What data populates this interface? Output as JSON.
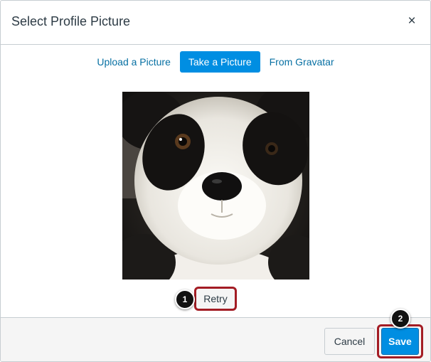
{
  "dialog": {
    "title": "Select Profile Picture",
    "close_symbol": "×"
  },
  "tabs": [
    {
      "label": "Upload a Picture",
      "active": false
    },
    {
      "label": "Take a Picture",
      "active": true
    },
    {
      "label": "From Gravatar",
      "active": false
    }
  ],
  "retry_label": "Retry",
  "callouts": [
    "1",
    "2"
  ],
  "footer": {
    "cancel_label": "Cancel",
    "save_label": "Save"
  },
  "colors": {
    "accent": "#008ee2",
    "link": "#0770a3",
    "highlight_border": "#a31c24"
  }
}
